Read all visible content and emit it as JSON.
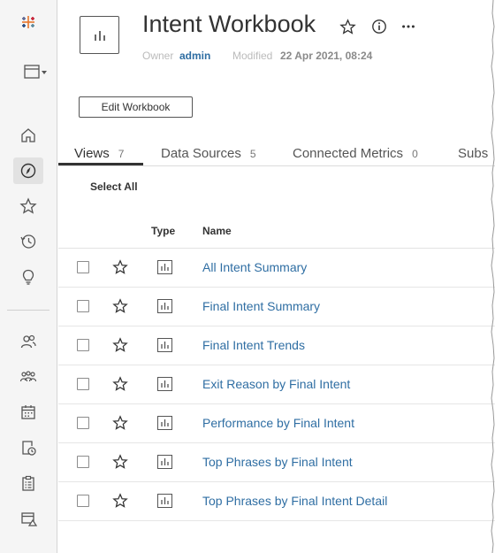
{
  "rail": {
    "icons": [
      "tableau-logo-icon",
      "browse-menu-icon",
      "home-icon",
      "explore-icon",
      "favorites-star-icon",
      "recents-clock-icon",
      "recommendations-bulb-icon",
      "users-icon",
      "groups-icon",
      "schedules-calendar-icon",
      "jobs-icon",
      "tasks-clipboard-icon",
      "data-alerts-icon"
    ]
  },
  "header": {
    "title": "Intent Workbook",
    "owner_label": "Owner",
    "owner": "admin",
    "modified_label": "Modified",
    "modified": "22 Apr 2021, 08:24",
    "edit_button": "Edit Workbook"
  },
  "tabs": [
    {
      "label": "Views",
      "count": "7"
    },
    {
      "label": "Data Sources",
      "count": "5"
    },
    {
      "label": "Connected Metrics",
      "count": "0"
    },
    {
      "label": "Subs",
      "count": ""
    }
  ],
  "select_all": "Select All",
  "table": {
    "columns": {
      "type": "Type",
      "name": "Name"
    },
    "rows": [
      "All Intent Summary",
      "Final Intent Summary",
      "Final Intent Trends",
      "Exit Reason by Final Intent",
      "Performance by Final Intent",
      "Top Phrases by Final Intent",
      "Top Phrases by Final Intent Detail"
    ]
  },
  "colors": {
    "link": "#2f6ea3",
    "rail_bg": "#f5f5f5",
    "text": "#333333"
  }
}
